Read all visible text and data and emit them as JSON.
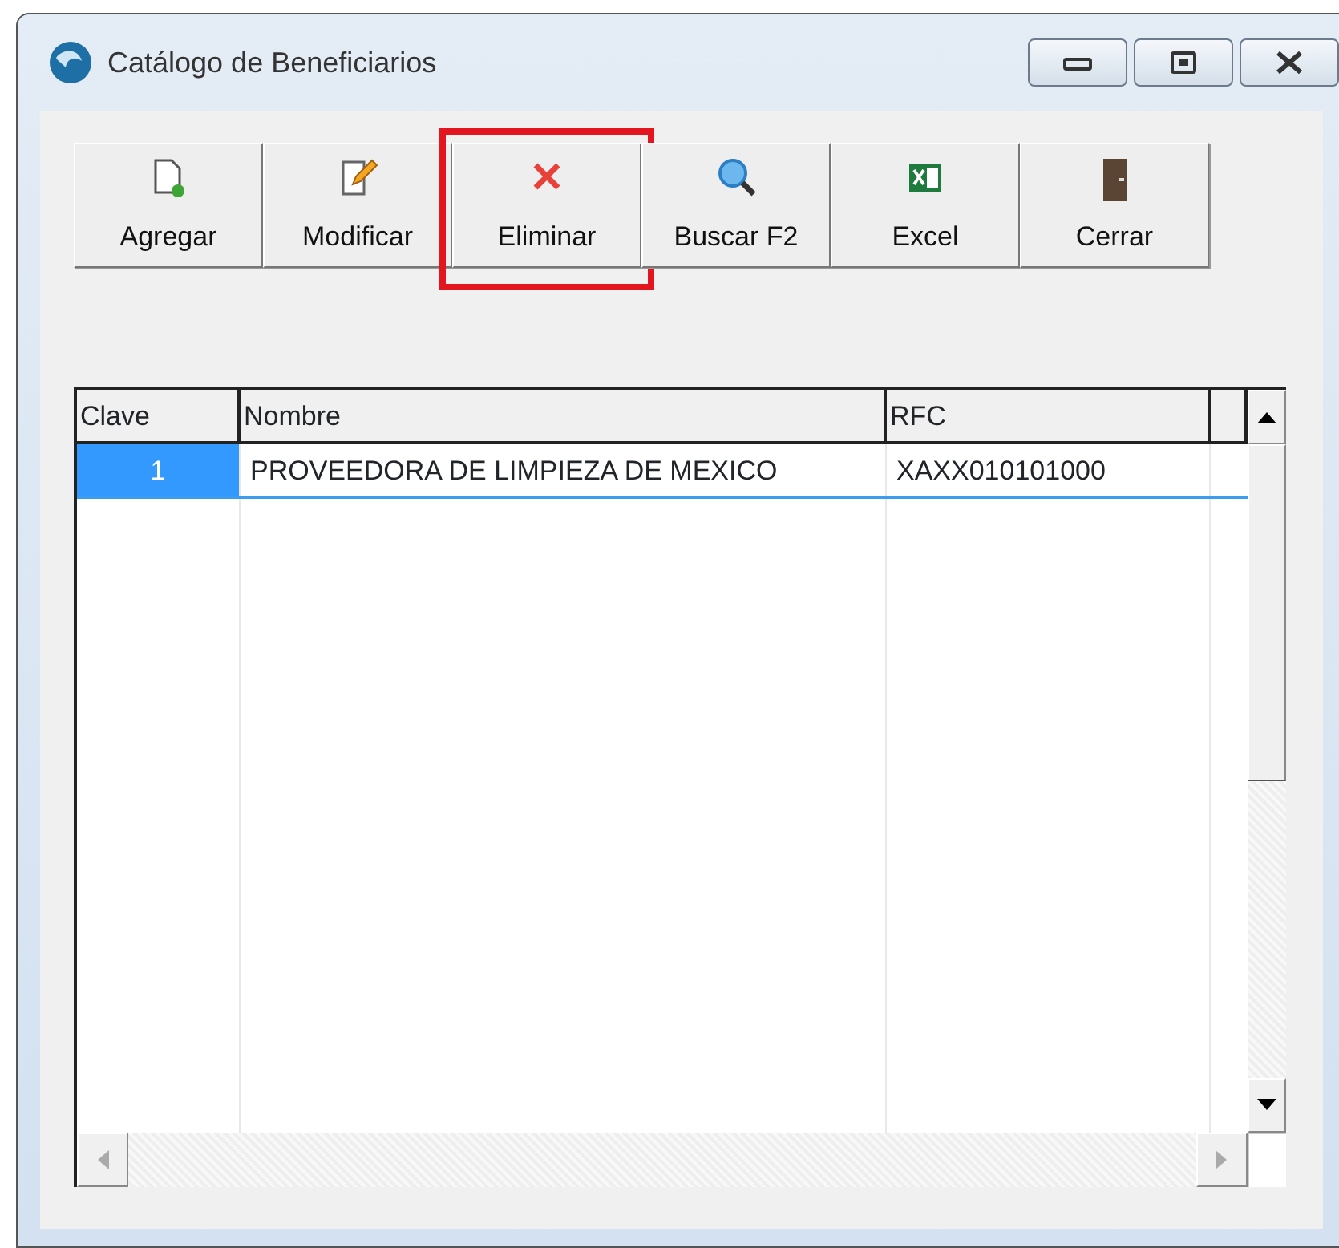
{
  "window": {
    "title": "Catálogo de Beneficiarios"
  },
  "toolbar": [
    {
      "label": "Agregar",
      "kind": "new",
      "highlighted": false
    },
    {
      "label": "Modificar",
      "kind": "edit",
      "highlighted": false
    },
    {
      "label": "Eliminar",
      "kind": "delete",
      "highlighted": true
    },
    {
      "label": "Buscar F2",
      "kind": "search",
      "highlighted": false
    },
    {
      "label": "Excel",
      "kind": "excel",
      "highlighted": false
    },
    {
      "label": "Cerrar",
      "kind": "door",
      "highlighted": false
    }
  ],
  "table": {
    "columns": [
      "Clave",
      "Nombre",
      "RFC"
    ],
    "rows": [
      {
        "cells": [
          "1",
          "PROVEEDORA DE LIMPIEZA DE MEXICO",
          "XAXX010101000"
        ],
        "selected": true
      }
    ]
  }
}
